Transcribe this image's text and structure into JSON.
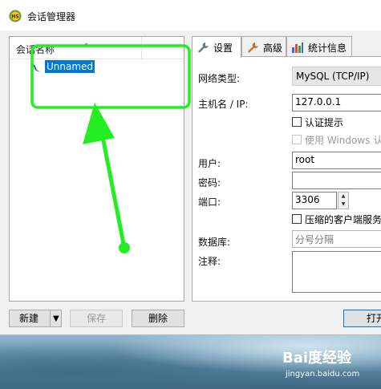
{
  "window": {
    "title": "会话管理器",
    "icon": "hs-app-icon",
    "icon_text": "HS"
  },
  "session_tree": {
    "header_label": "会话名称",
    "sort_indicator": "^",
    "sessions": [
      {
        "name": "Unnamed",
        "selected": true,
        "icon": "mysql-dolphin-icon"
      }
    ]
  },
  "tabs": [
    {
      "label": "设置",
      "icon": "wrench-icon",
      "active": true
    },
    {
      "label": "高级",
      "icon": "wrench-icon",
      "active": false
    },
    {
      "label": "统计信息",
      "icon": "bar-chart-icon",
      "active": false
    }
  ],
  "settings": {
    "network_type_label": "网络类型:",
    "network_type_value": "MySQL (TCP/IP)",
    "host_label": "主机名 / IP:",
    "host_value": "127.0.0.1",
    "auth_prompt_label": "认证提示",
    "auth_prompt_checked": false,
    "windows_auth_label": "使用 Windows 认",
    "windows_auth_enabled": false,
    "user_label": "用户:",
    "user_value": "root",
    "password_label": "密码:",
    "password_value": "",
    "port_label": "端口:",
    "port_value": "3306",
    "compressed_label": "压缩的客户端服务",
    "compressed_checked": false,
    "database_label": "数据库:",
    "database_placeholder": "分号分隔",
    "comment_label": "注释:",
    "comment_value": ""
  },
  "buttons": {
    "new": "新建",
    "save": "保存",
    "delete": "删除",
    "open": "打开"
  },
  "watermark": {
    "main": "Bai度经验",
    "sub": "jingyan.baidu.com"
  },
  "colors": {
    "selection": "#0078d7",
    "annotation": "#22ee22",
    "window_bg": "#f0f0f0"
  }
}
